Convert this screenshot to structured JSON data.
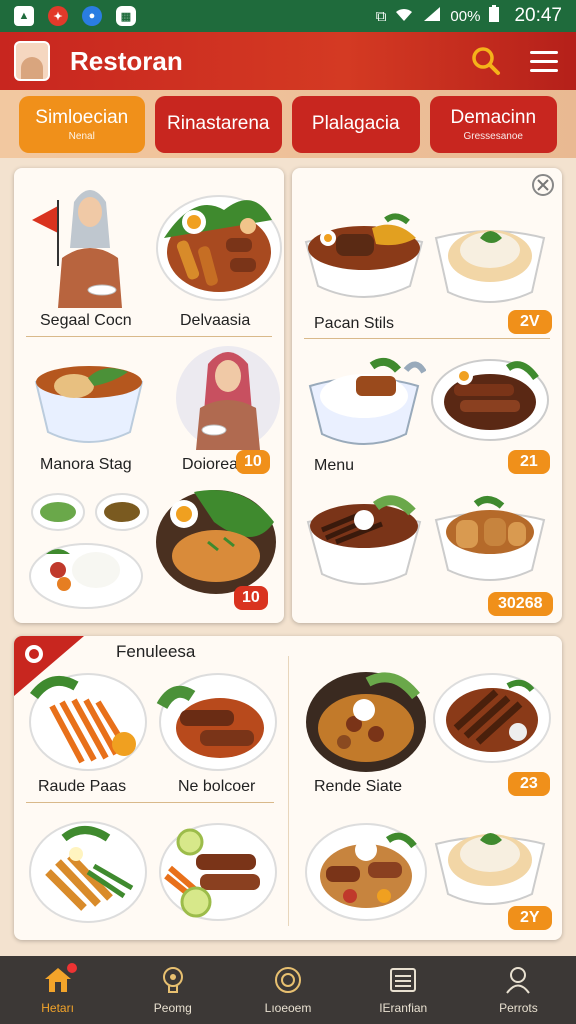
{
  "status": {
    "percent": "00%",
    "time": "20:47"
  },
  "header": {
    "title": "Restoran"
  },
  "tabs": [
    {
      "label": "Simloecian",
      "sub": "Nenal"
    },
    {
      "label": "Rinastarena",
      "sub": ""
    },
    {
      "label": "Plalagacia",
      "sub": ""
    },
    {
      "label": "Demacinn",
      "sub": "Gressesanoe"
    }
  ],
  "panel1": {
    "items": [
      {
        "label": "Segaal Cocn"
      },
      {
        "label": "Delvaasia"
      },
      {
        "label": "Manora Stag"
      },
      {
        "label": "Doiorea",
        "price": "10"
      },
      {
        "price": "10"
      }
    ]
  },
  "panel2": {
    "items": [
      {
        "label": "Pacan Stils",
        "price": "2V"
      },
      {
        "label": "Menu",
        "price": "21"
      },
      {
        "price": "30268"
      }
    ]
  },
  "panel3": {
    "title": "Fenuleesa",
    "items": [
      {
        "label": "Raude Paas"
      },
      {
        "label": "Ne bolcoer"
      },
      {
        "label": "Rende Siate",
        "price": "23"
      },
      {
        "price": "2Y"
      }
    ]
  },
  "nav": [
    {
      "label": "Hetarı",
      "icon": "home-icon"
    },
    {
      "label": "Peomg",
      "icon": "chef-icon"
    },
    {
      "label": "Lıoeoem",
      "icon": "plate-icon"
    },
    {
      "label": "IEranfian",
      "icon": "list-icon"
    },
    {
      "label": "Perrots",
      "icon": "profile-icon"
    }
  ]
}
